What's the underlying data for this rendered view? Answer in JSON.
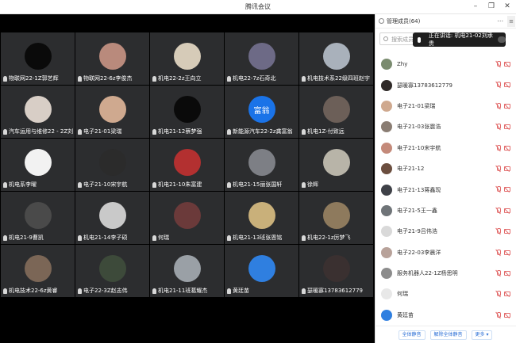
{
  "window": {
    "title": "腾讯会议"
  },
  "grid": {
    "tiles": [
      {
        "name": "物联网22-1Z郭艺辉",
        "avatar": "#0a0a0a"
      },
      {
        "name": "物联网22-6z李俊杰",
        "avatar": "#b98a7c"
      },
      {
        "name": "机电22-2z王向立",
        "avatar": "#d6cbb8"
      },
      {
        "name": "机电22-7z石奇北",
        "avatar": "#6d6a86"
      },
      {
        "name": "机电技术系22级四班赵宇",
        "avatar": "#a9b1bb"
      },
      {
        "name": "汽车运用与维修22 - 2Z刘…",
        "avatar": "#d8cec6"
      },
      {
        "name": "电子21-01梁瑞",
        "avatar": "#cfa98f"
      },
      {
        "name": "机电21-12蔡梦强",
        "avatar": "#0a0a0a"
      },
      {
        "name": "新能源汽车22-2z龚富翁",
        "avatar": "#1a73e8",
        "avatar_text": "富翁"
      },
      {
        "name": "机电1Z-付致远",
        "avatar": "#6c5f58"
      },
      {
        "name": "机电系李曜",
        "avatar": "#f2f2f2"
      },
      {
        "name": "电子21-10宋宇航",
        "avatar": "#2b2b2b"
      },
      {
        "name": "机电21-10朱富建",
        "avatar": "#b33030"
      },
      {
        "name": "机电21-15丽张国轩",
        "avatar": "#7d7f85"
      },
      {
        "name": "徐辉",
        "avatar": "#b8b4a8"
      },
      {
        "name": "机电21-9曹凯",
        "avatar": "#4a4a4a"
      },
      {
        "name": "机电21-14李子硕",
        "avatar": "#c9c9c9"
      },
      {
        "name": "何瑞",
        "avatar": "#6b3a3a"
      },
      {
        "name": "机电21-13班张恩铭",
        "avatar": "#c9b07a"
      },
      {
        "name": "机电22-1z厉梦飞",
        "avatar": "#8e7a5d"
      },
      {
        "name": "机电技术22-6z黄睿",
        "avatar": "#7b6656"
      },
      {
        "name": "电子22-3Z赵志伟",
        "avatar": "#3d4a3a"
      },
      {
        "name": "机电21-11班葛耀杰",
        "avatar": "#9aa0a6"
      },
      {
        "name": "黄廷苗",
        "avatar": "#2f7fe0"
      },
      {
        "name": "瑟暖寡13783612779",
        "avatar": "#3a3030"
      }
    ]
  },
  "panel": {
    "title": "管理成员(64)",
    "more": "⋯",
    "close": "×",
    "side_toggle": "≡",
    "search_placeholder": "搜索成员",
    "speaking_label": "正在讲话: 机电21-02刘承贵",
    "members": [
      {
        "name": "Zhy",
        "avatar": "#7a8b6f"
      },
      {
        "name": "瑟暖寡13783612779",
        "avatar": "#2f2a28"
      },
      {
        "name": "电子21-01梁瑞",
        "avatar": "#cfa98f"
      },
      {
        "name": "电子21-03张震浩",
        "avatar": "#8a7d73"
      },
      {
        "name": "电子21-10宋宇航",
        "avatar": "#c48a7a"
      },
      {
        "name": "电子21-12",
        "avatar": "#6b4e3f"
      },
      {
        "name": "电子21-13蒋鑫现",
        "avatar": "#3f4148"
      },
      {
        "name": "电子21-5王一鑫",
        "avatar": "#6f7478"
      },
      {
        "name": "电子21-9吕伟浩",
        "avatar": "#d9d9d9"
      },
      {
        "name": "电子22-03李晨洋",
        "avatar": "#b8a29a"
      },
      {
        "name": "服务机器人22-1Z杨思明",
        "avatar": "#8c8c8c"
      },
      {
        "name": "何瑞",
        "avatar": "#e8e8e8"
      },
      {
        "name": "黄廷苗",
        "avatar": "#2f7fe0"
      }
    ],
    "footer": {
      "mute_all": "全体静音",
      "unmute_all": "解除全体静音",
      "more": "更多 ▾"
    }
  }
}
